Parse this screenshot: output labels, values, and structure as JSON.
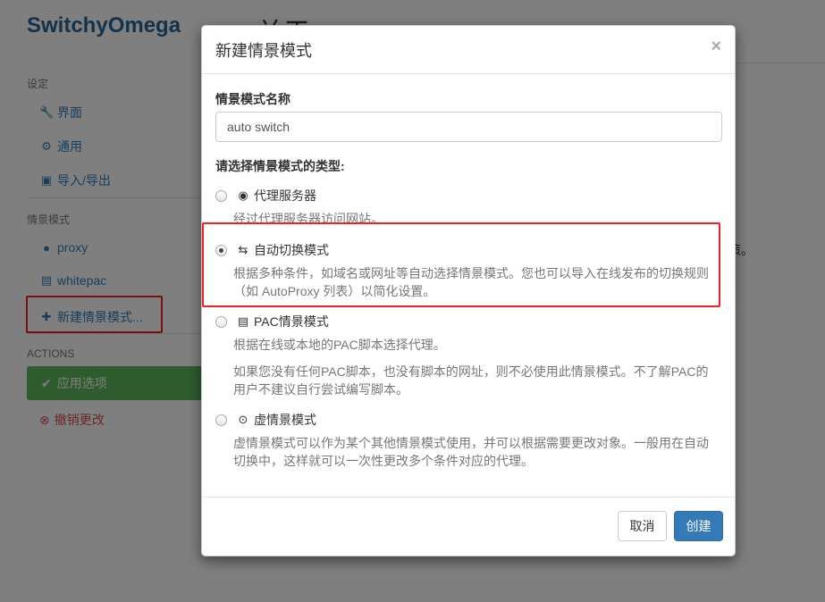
{
  "app": {
    "brand": "SwitchyOmega",
    "main_title": "关于",
    "main_trail": "策。"
  },
  "sidebar": {
    "settings_header": "设定",
    "settings_items": [
      {
        "label": "界面",
        "icon": "wrench-icon"
      },
      {
        "label": "通用",
        "icon": "gear-icon"
      },
      {
        "label": "导入/导出",
        "icon": "floppy-icon"
      }
    ],
    "profiles_header": "情景模式",
    "profile_items": [
      {
        "label": "proxy",
        "icon": "globe-icon"
      },
      {
        "label": "whitepac",
        "icon": "file-icon"
      },
      {
        "label": "新建情景模式...",
        "icon": "plus-icon"
      }
    ],
    "actions_header": "ACTIONS",
    "apply_label": "应用选项",
    "revert_label": "撤销更改"
  },
  "modal": {
    "title": "新建情景模式",
    "close": "×",
    "name_label": "情景模式名称",
    "name_value": "auto switch",
    "type_label": "请选择情景模式的类型:",
    "options": [
      {
        "label": "代理服务器",
        "icon": "globe-icon",
        "checked": false,
        "desc": "经过代理服务器访问网站。"
      },
      {
        "label": "自动切换模式",
        "icon": "retweet-icon",
        "checked": true,
        "desc": "根据多种条件，如域名或网址等自动选择情景模式。您也可以导入在线发布的切换规则（如 AutoProxy 列表）以简化设置。"
      },
      {
        "label": "PAC情景模式",
        "icon": "file-icon",
        "checked": false,
        "desc": "根据在线或本地的PAC脚本选择代理。",
        "desc2": "如果您没有任何PAC脚本，也没有脚本的网址，则不必使用此情景模式。不了解PAC的用户不建议自行尝试编写脚本。"
      },
      {
        "label": "虚情景模式",
        "icon": "virtual-icon",
        "checked": false,
        "desc": "虚情景模式可以作为某个其他情景模式使用，并可以根据需要更改对象。一般用在自动切换中，这样就可以一次性更改多个条件对应的代理。"
      }
    ],
    "cancel_label": "取消",
    "create_label": "创建"
  },
  "colors": {
    "brand": "#2a6496",
    "link": "#337ab7",
    "success": "#5cb85c",
    "danger": "#d9534f",
    "primary": "#337ab7",
    "highlight": "#ee2222"
  }
}
